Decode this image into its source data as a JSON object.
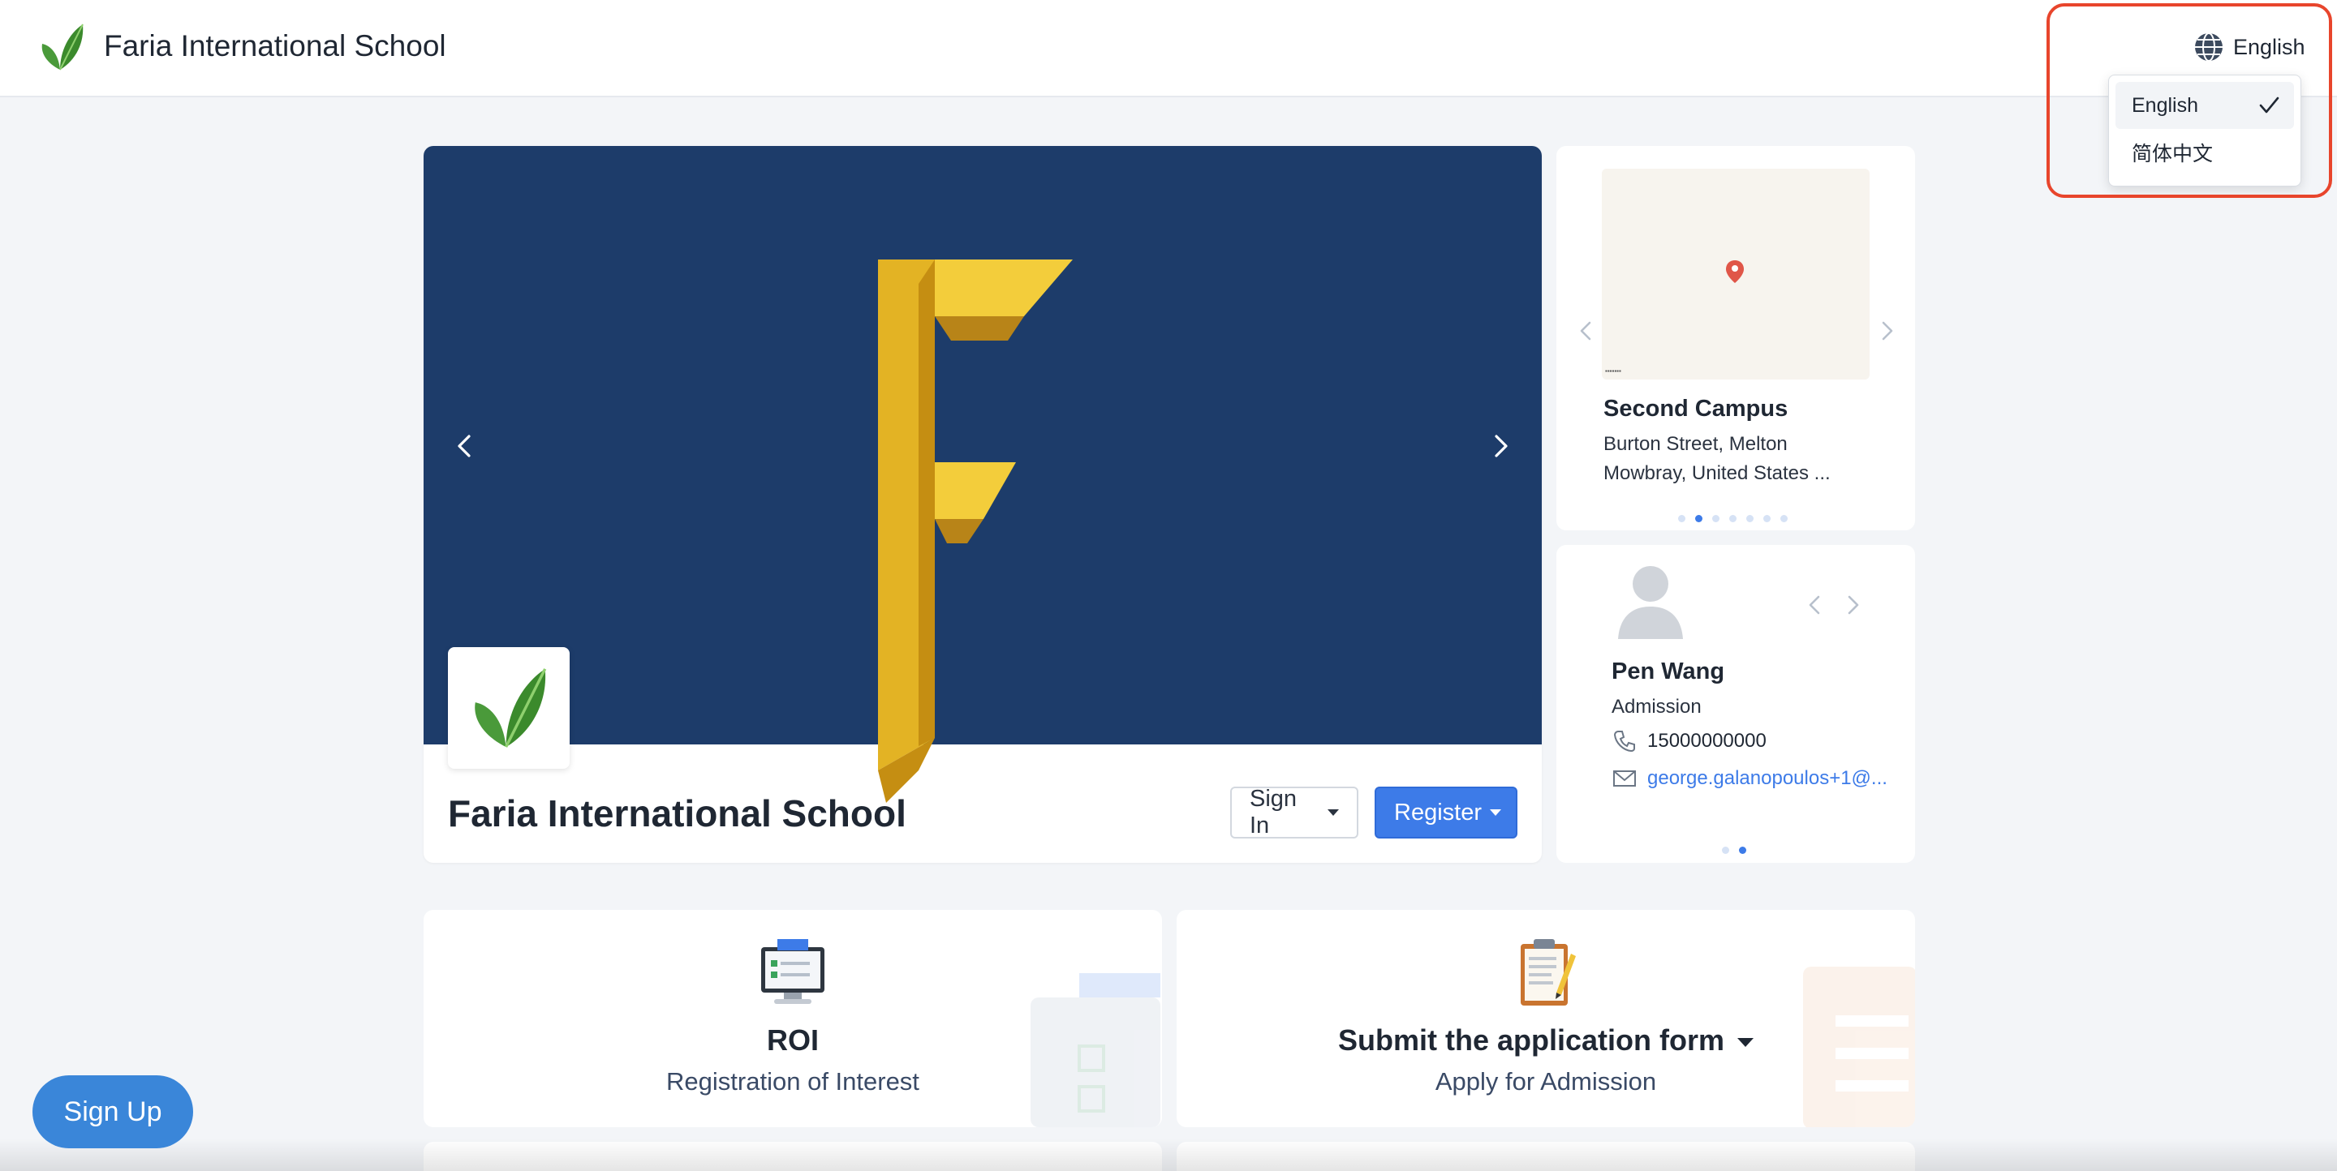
{
  "header": {
    "school_name": "Faria International School",
    "language_label": "English"
  },
  "language_menu": {
    "options": [
      {
        "label": "English",
        "selected": true
      },
      {
        "label": "简体中文",
        "selected": false
      }
    ]
  },
  "hero": {
    "title": "Faria International School",
    "sign_in_label": "Sign In",
    "register_label": "Register"
  },
  "campus": {
    "name": "Second Campus",
    "address": "Burton Street, Melton Mowbray, United States ...",
    "slide_count": 7,
    "active_slide": 2
  },
  "contact": {
    "name": "Pen Wang",
    "role": "Admission",
    "phone": "15000000000",
    "email": "george.galanopoulos+1@...",
    "slide_count": 2,
    "active_slide": 2
  },
  "actions": [
    {
      "title": "ROI",
      "subtitle": "Registration of Interest",
      "icon": "monitor-checklist-icon"
    },
    {
      "title": "Submit the application form",
      "subtitle": "Apply for Admission",
      "icon": "clipboard-pen-icon"
    }
  ],
  "signup_label": "Sign Up",
  "colors": {
    "accent": "#3d7be8",
    "banner": "#1d3c6a",
    "highlight": "#e8452c",
    "background": "#f3f5f8"
  }
}
